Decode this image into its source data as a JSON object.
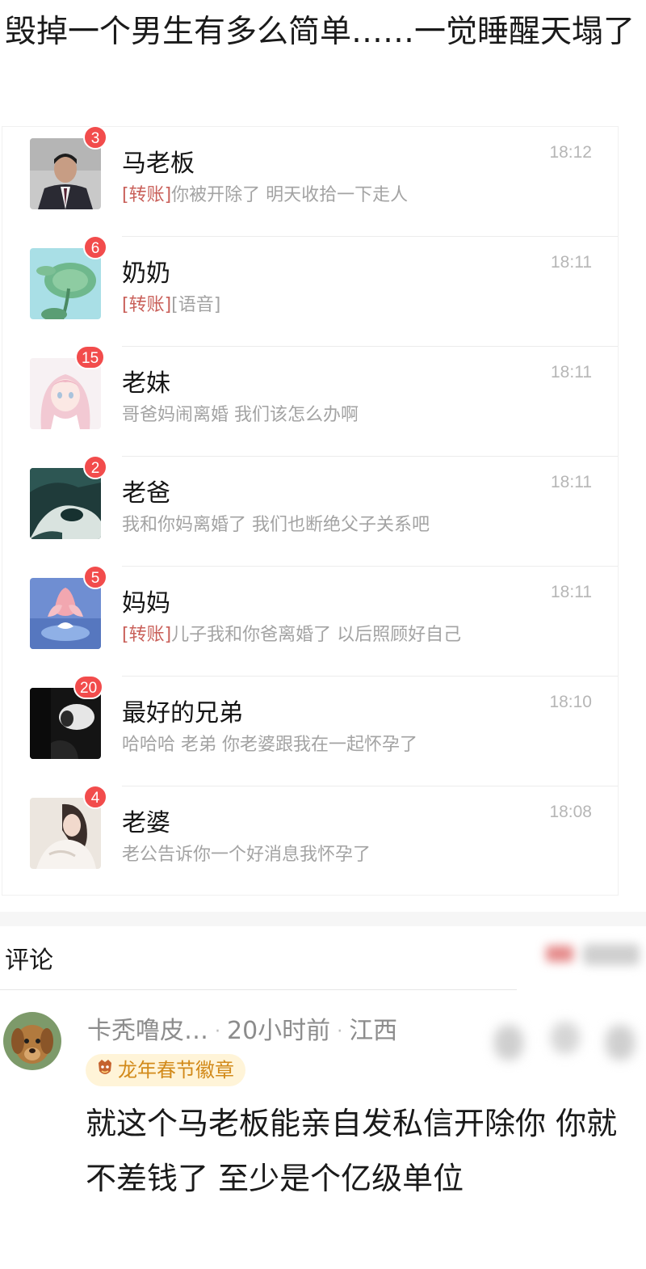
{
  "post": {
    "title": "毁掉一个男生有多么简单……一觉睡醒天塌了"
  },
  "chats": [
    {
      "name": "马老板",
      "time": "18:12",
      "unread": "3",
      "tag": "[转账]",
      "preview": "你被开除了 明天收拾一下走人",
      "avatar_icon": "businessman-avatar"
    },
    {
      "name": "奶奶",
      "time": "18:11",
      "unread": "6",
      "tag": "[转账]",
      "preview": "[语音]",
      "avatar_icon": "lotus-leaf-avatar"
    },
    {
      "name": "老妹",
      "time": "18:11",
      "unread": "15",
      "tag": "",
      "preview": "哥爸妈闹离婚 我们该怎么办啊",
      "avatar_icon": "anime-girl-avatar"
    },
    {
      "name": "老爸",
      "time": "18:11",
      "unread": "2",
      "tag": "",
      "preview": "我和你妈离婚了 我们也断绝父子关系吧",
      "avatar_icon": "landscape-avatar"
    },
    {
      "name": "妈妈",
      "time": "18:11",
      "unread": "5",
      "tag": "[转账]",
      "preview": "儿子我和你爸离婚了 以后照顾好自己",
      "avatar_icon": "lotus-flower-avatar"
    },
    {
      "name": "最好的兄弟",
      "time": "18:10",
      "unread": "20",
      "tag": "",
      "preview": "哈哈哈 老弟 你老婆跟我在一起怀孕了",
      "avatar_icon": "dark-photo-avatar"
    },
    {
      "name": "老婆",
      "time": "18:08",
      "unread": "4",
      "tag": "",
      "preview": "老公告诉你一个好消息我怀孕了",
      "avatar_icon": "woman-photo-avatar"
    }
  ],
  "comments": {
    "title": "评论",
    "items": [
      {
        "author": "卡秃噜皮…",
        "time": "20小时前",
        "location": "江西",
        "badge": "龙年春节徽章",
        "text": "就这个马老板能亲自发私信开除你 你就不差钱了 至少是个亿级单位"
      }
    ]
  },
  "colors": {
    "unread_badge": "#f24c4c",
    "transfer_tag": "#c9605a",
    "badge_pill_bg": "#fff4d8",
    "badge_pill_text": "#d28a1a"
  }
}
